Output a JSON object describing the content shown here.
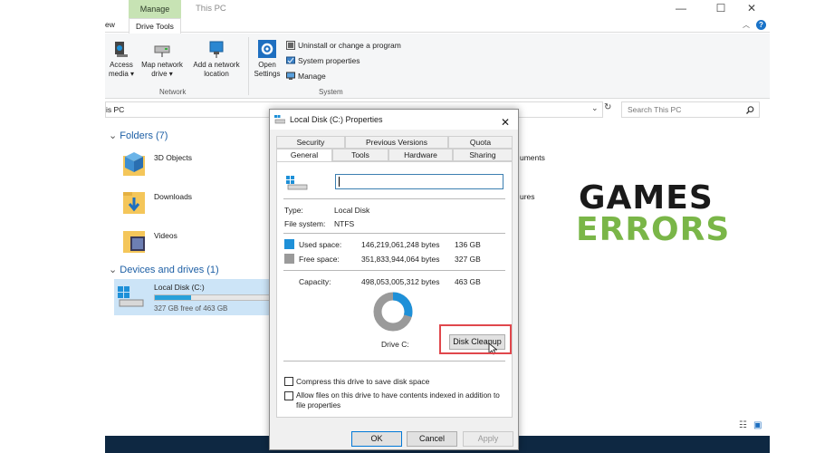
{
  "window": {
    "title": "This PC",
    "minimize": "—",
    "maximize": "☐",
    "close": "✕"
  },
  "ribbon": {
    "tab_view": "ew",
    "context_group": "Manage",
    "tab_drive_tools": "Drive Tools",
    "network": {
      "access_media": "Access\nmedia ▾",
      "map_network_drive": "Map network\ndrive ▾",
      "add_network_location": "Add a network\nlocation",
      "label": "Network"
    },
    "system": {
      "open_settings": "Open\nSettings",
      "uninstall": "Uninstall or change a program",
      "system_properties": "System properties",
      "manage": "Manage",
      "label": "System"
    }
  },
  "address": {
    "path": "is PC",
    "search_placeholder": "Search This PC"
  },
  "folders": {
    "header": "Folders (7)",
    "items": [
      "3D Objects",
      "Downloads",
      "Videos"
    ],
    "partial_right": [
      "uments",
      "ures"
    ]
  },
  "devices": {
    "header": "Devices and drives (1)",
    "drive_name": "Local Disk (C:)",
    "drive_free": "327 GB free of 463 GB",
    "used_fraction": 0.29
  },
  "dialog": {
    "title": "Local Disk (C:) Properties",
    "close": "✕",
    "tabs_row1": [
      "Security",
      "Previous Versions",
      "Quota"
    ],
    "tabs_row2": [
      "General",
      "Tools",
      "Hardware",
      "Sharing"
    ],
    "name_value": "",
    "type_label": "Type:",
    "type_value": "Local Disk",
    "fs_label": "File system:",
    "fs_value": "NTFS",
    "used_label": "Used space:",
    "used_bytes": "146,219,061,248 bytes",
    "used_gb": "136 GB",
    "free_label": "Free space:",
    "free_bytes": "351,833,944,064 bytes",
    "free_gb": "327 GB",
    "capacity_label": "Capacity:",
    "capacity_bytes": "498,053,005,312 bytes",
    "capacity_gb": "463 GB",
    "drive_label": "Drive C:",
    "disk_cleanup": "Disk Cleanup",
    "compress": "Compress this drive to save disk space",
    "index_line1": "Allow files on this drive to have contents indexed in addition to",
    "index_line2": "file properties",
    "ok": "OK",
    "cancel": "Cancel",
    "apply": "Apply",
    "used_color": "#1e90d8",
    "free_color": "#9a9a9a",
    "used_fraction": 0.294
  },
  "logo": {
    "line1": "GAMES",
    "line2": "ERRORS"
  }
}
